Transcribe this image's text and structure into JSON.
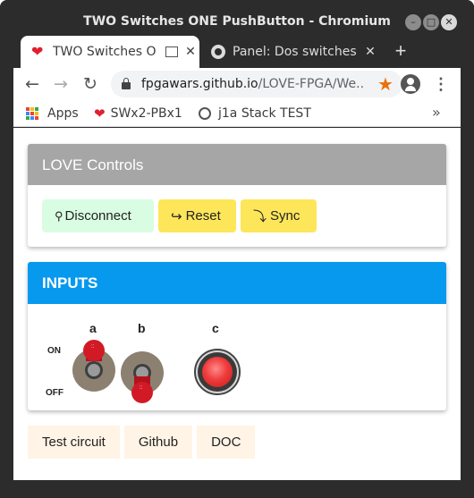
{
  "window": {
    "title": "TWO Switches ONE PushButton - Chromium"
  },
  "tabs": [
    {
      "label": "TWO Switches O",
      "icon": "heart-icon",
      "active": true
    },
    {
      "label": "Panel: Dos switches",
      "icon": "github-icon",
      "active": false
    }
  ],
  "toolbar": {
    "url_host": "fpgawars.github.io",
    "url_path": "/LOVE-FPGA/We..."
  },
  "bookmarks": [
    {
      "label": "Apps",
      "icon": "apps-grid-icon"
    },
    {
      "label": "SWx2-PBx1",
      "icon": "heart-icon"
    },
    {
      "label": "j1a Stack TEST",
      "icon": "globe-icon"
    }
  ],
  "love_controls": {
    "title": "LOVE Controls",
    "disconnect_icon": "⚲",
    "disconnect_label": "Disconnect",
    "reset_icon": "↪",
    "reset_label": "Reset",
    "sync_icon": "⤵",
    "sync_label": "Sync",
    "colors": {
      "header": "#a6a6a6",
      "disconnect": "#d9fde2",
      "reset_sync": "#fde65a"
    }
  },
  "inputs": {
    "title": "INPUTS",
    "on_label": "ON",
    "off_label": "OFF",
    "switch_a": {
      "label": "a",
      "state": "on"
    },
    "switch_b": {
      "label": "b",
      "state": "off"
    },
    "button_c": {
      "label": "c",
      "state": "released"
    },
    "colors": {
      "header": "#0699ee",
      "lever": "#d21a27"
    }
  },
  "footer_links": [
    "Test circuit",
    "Github",
    "DOC"
  ]
}
